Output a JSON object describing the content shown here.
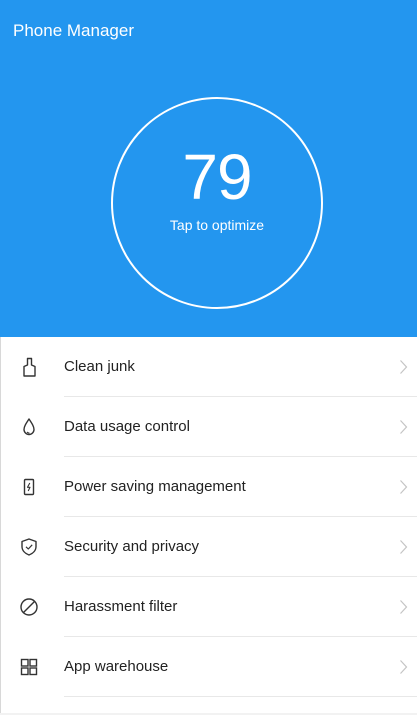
{
  "app": {
    "title": "Phone Manager",
    "accent_color": "#2396ef"
  },
  "score": {
    "value": "79",
    "hint": "Tap to optimize"
  },
  "menu": {
    "items": [
      {
        "label": "Clean junk",
        "icon": "clean-junk-icon"
      },
      {
        "label": "Data usage control",
        "icon": "data-drop-icon"
      },
      {
        "label": "Power saving management",
        "icon": "battery-icon"
      },
      {
        "label": "Security and privacy",
        "icon": "shield-icon"
      },
      {
        "label": "Harassment filter",
        "icon": "block-icon"
      },
      {
        "label": "App warehouse",
        "icon": "app-grid-icon"
      }
    ]
  }
}
